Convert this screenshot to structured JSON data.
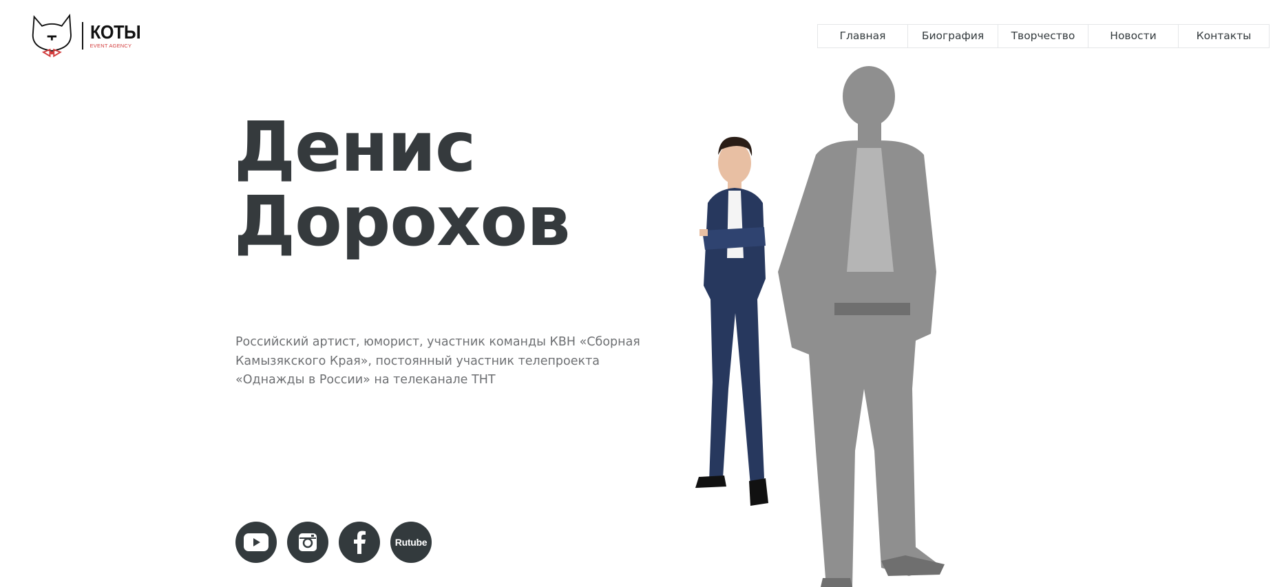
{
  "logo": {
    "name": "КОТЫ",
    "subtitle": "EVENT AGENCY",
    "icon": "cat-bowtie-icon",
    "accent": "#d23a3a"
  },
  "nav": {
    "items": [
      {
        "label": "Главная"
      },
      {
        "label": "Биография"
      },
      {
        "label": "Творчество"
      },
      {
        "label": "Новости"
      },
      {
        "label": "Контакты"
      }
    ]
  },
  "hero": {
    "first_name": "Денис",
    "last_name": "Дорохов",
    "description": "Российский артист, юморист, участник команды КВН «Сборная Камызякского Края», постоянный участник телепроекта «Однажды в России» на телеканале ТНТ"
  },
  "socials": [
    {
      "icon": "youtube-icon"
    },
    {
      "icon": "instagram-icon"
    },
    {
      "icon": "facebook-icon"
    },
    {
      "icon": "rutube-icon",
      "label": "Rutube"
    }
  ],
  "colors": {
    "text_dark": "#353a3d",
    "text_muted": "#6d6f72",
    "border": "#e4e6e8",
    "suit_navy": "#27385e",
    "ghost_gray": "#8c8c8c"
  }
}
